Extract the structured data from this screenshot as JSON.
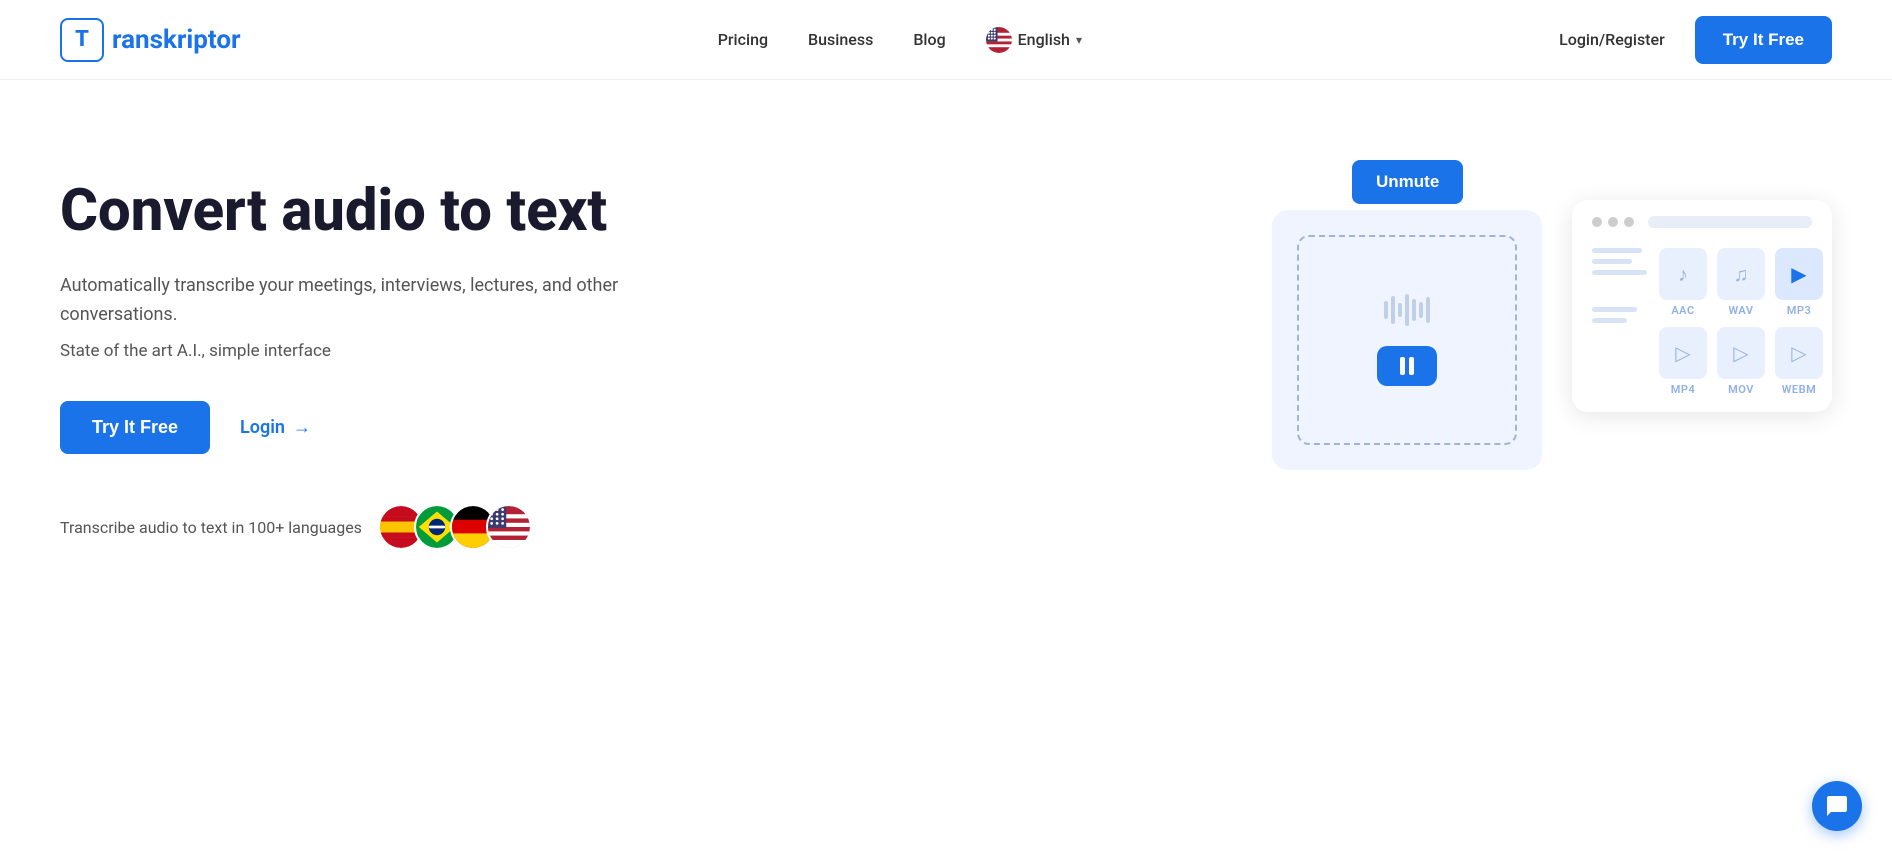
{
  "header": {
    "logo_letter": "T",
    "logo_name": "ranskriptor",
    "nav": {
      "pricing": "Pricing",
      "business": "Business",
      "blog": "Blog"
    },
    "language": {
      "label": "English",
      "flag": "🇺🇸"
    },
    "login_register": "Login/Register",
    "try_button": "Try It Free"
  },
  "hero": {
    "title": "Convert audio to text",
    "desc1": "Automatically transcribe your meetings, interviews, lectures, and other conversations.",
    "desc2": "State of the art A.I., simple interface",
    "try_button": "Try It Free",
    "login_label": "Login",
    "login_arrow": "→",
    "languages_text": "Transcribe audio to text in 100+ languages",
    "flags": [
      "🇪🇸",
      "🇧🇷",
      "🇩🇪",
      "🇺🇸"
    ]
  },
  "illustration": {
    "unmute_button": "Unmute",
    "formats": [
      "AAC",
      "WAV",
      "MP3",
      "MP4",
      "MOV",
      "WEBM"
    ]
  },
  "chat": {
    "icon": "chat"
  }
}
